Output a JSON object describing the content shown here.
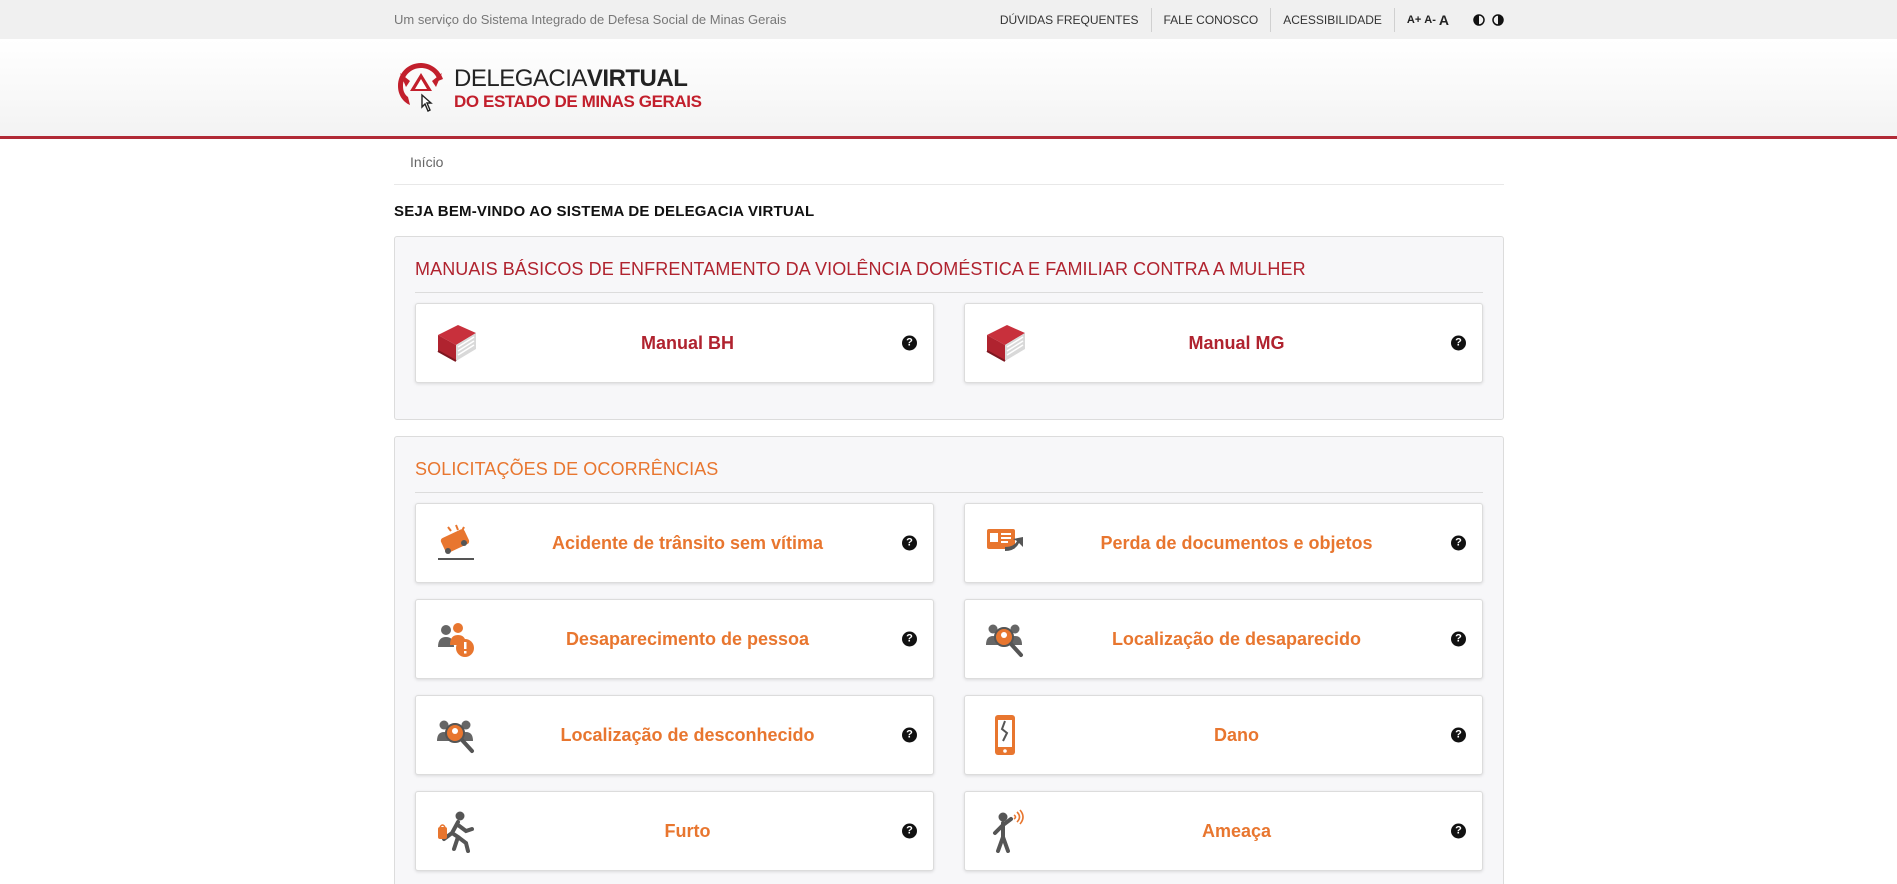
{
  "topbar": {
    "service_text": "Um serviço do Sistema Integrado de Defesa Social de Minas Gerais",
    "links": [
      "DÚVIDAS FREQUENTES",
      "FALE CONOSCO",
      "ACESSIBILIDADE"
    ],
    "font_controls": [
      "A+",
      "A-",
      "A"
    ]
  },
  "logo": {
    "line1_thin": "DELEGACIA",
    "line1_bold": "VIRTUAL",
    "line2": "DO ESTADO DE MINAS GERAIS"
  },
  "breadcrumb": {
    "home": "Início"
  },
  "welcome": "SEJA BEM-VINDO AO SISTEMA DE DELEGACIA VIRTUAL",
  "manuals": {
    "title": "MANUAIS BÁSICOS DE ENFRENTAMENTO DA VIOLÊNCIA DOMÉSTICA E FAMILIAR CONTRA A MULHER",
    "items": [
      {
        "label": "Manual BH",
        "icon": "book-icon"
      },
      {
        "label": "Manual MG",
        "icon": "book-icon"
      }
    ]
  },
  "requests": {
    "title": "SOLICITAÇÕES DE OCORRÊNCIAS",
    "items": [
      {
        "label": "Acidente de trânsito sem vítima",
        "icon": "car-accident-icon"
      },
      {
        "label": "Perda de documentos e objetos",
        "icon": "lost-documents-icon"
      },
      {
        "label": "Desaparecimento de pessoa",
        "icon": "missing-person-icon"
      },
      {
        "label": "Localização de desaparecido",
        "icon": "locate-missing-icon"
      },
      {
        "label": "Localização de desconhecido",
        "icon": "locate-unknown-icon"
      },
      {
        "label": "Dano",
        "icon": "broken-phone-icon"
      },
      {
        "label": "Furto",
        "icon": "theft-icon"
      },
      {
        "label": "Ameaça",
        "icon": "threat-icon"
      }
    ]
  },
  "help_symbol": "?",
  "colors": {
    "brand_red": "#b0232f",
    "accent_orange": "#e8762f",
    "header_border": "#b12a36"
  }
}
